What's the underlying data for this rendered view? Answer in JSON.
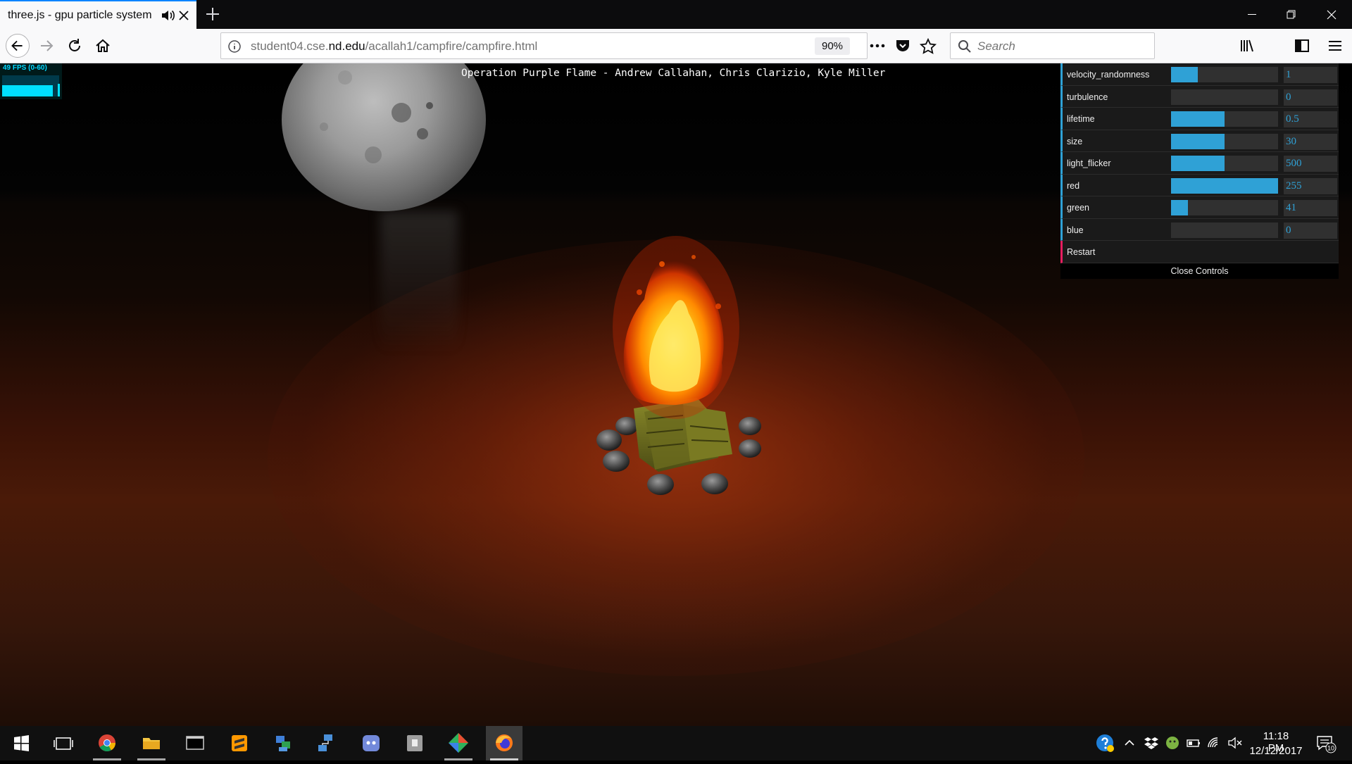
{
  "browser": {
    "tab_title": "three.js - gpu particle system",
    "url_host_pre": "student04.cse.",
    "url_host_domain": "nd.edu",
    "url_path": "/acallah1/campfire/campfire.html",
    "zoom": "90%",
    "search_placeholder": "Search",
    "icons": [
      "speaker-icon",
      "close-icon",
      "plus-icon",
      "back-arrow-icon",
      "forward-arrow-icon",
      "reload-icon",
      "home-icon",
      "info-icon",
      "ellipsis-icon",
      "pocket-icon",
      "star-icon",
      "search-icon",
      "library-icon",
      "sidebar-icon",
      "hamburger-icon"
    ]
  },
  "scene": {
    "title": "Operation Purple Flame - Andrew Callahan, Chris Clarizio, Kyle Miller",
    "fps_label": "49 FPS (0-60)"
  },
  "controls": {
    "accent_color": "#2fa1d6",
    "function_color": "#e61d5f",
    "rows": [
      {
        "label": "velocity_randomness",
        "value": "1",
        "fill": 0.25
      },
      {
        "label": "turbulence",
        "value": "0",
        "fill": 0.0
      },
      {
        "label": "lifetime",
        "value": "0.5",
        "fill": 0.5
      },
      {
        "label": "size",
        "value": "30",
        "fill": 0.5
      },
      {
        "label": "light_flicker",
        "value": "500",
        "fill": 0.5
      },
      {
        "label": "red",
        "value": "255",
        "fill": 1.0
      },
      {
        "label": "green",
        "value": "41",
        "fill": 0.16
      },
      {
        "label": "blue",
        "value": "0",
        "fill": 0.0
      }
    ],
    "restart_label": "Restart",
    "close_label": "Close Controls"
  },
  "taskbar": {
    "apps": [
      "windows-start-icon",
      "task-view-icon",
      "chrome-icon",
      "file-explorer-icon",
      "terminal-icon",
      "sublime-text-icon",
      "network-app-icon",
      "remote-desktop-icon",
      "discord-icon",
      "app-icon",
      "git-icon",
      "firefox-icon"
    ],
    "time": "11:18 PM",
    "date": "12/12/2017",
    "notification_count": "10"
  }
}
